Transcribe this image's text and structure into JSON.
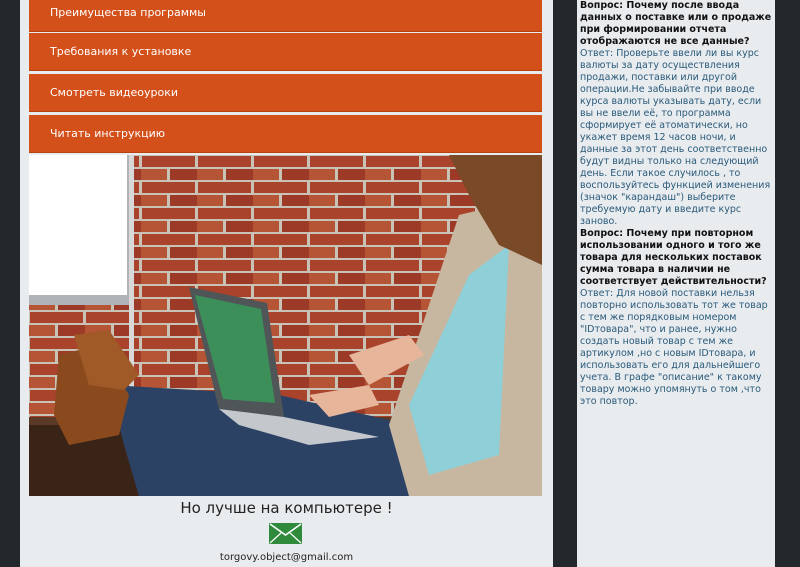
{
  "menu": [
    {
      "label": "Преимущества программы"
    },
    {
      "label": "Требования к установке"
    },
    {
      "label": "Смотреть видеоуроки"
    },
    {
      "label": "Читать инструкцию"
    }
  ],
  "footer": {
    "tagline": "Но лучше на компьютере !",
    "email": "torgovy.object@gmail.com"
  },
  "faq": [
    {
      "question": "Вопрос: Почему после ввода данных о поставке или о продаже при формировании отчета отображаются не все данные?",
      "answer": "Ответ: Проверьте ввели ли вы курс валюты за дату осуществления продажи, поставки или другой операции.Не забывайте при вводе курса валюты указывать дату, если вы не ввели её, то программа сформирует её атоматически, но укажет время 12 часов ночи, и данные за этот день соответственно будут видны только на следующий день. Если такое случилось , то воспользуйтесь функцией изменения (значок \"карандаш\") выберите требуемую дату и введите курс заново."
    },
    {
      "question": "Вопрос: Почему при повторном использовании одного и того же товара для нескольких поставок сумма товара в наличии не соответствует действительности?",
      "answer": "Ответ: Для новой поставки нельзя повторно использовать тот же товар с тем же порядковым номером \"IDтовара\", что и ранее, нужно создать новый товар с тем же артикулом ,но с новым IDтовара, и использовать его для дальнейшего учета. В графе \"описание\" к такому товару можно упомянуть о том ,что это повтор."
    }
  ],
  "colors": {
    "menu_bg": "#d4501a",
    "panel_bg": "#e8ecef",
    "page_bg": "#23282d",
    "answer_text": "#2a5a7a"
  },
  "icons": {
    "mail": "envelope-icon"
  }
}
